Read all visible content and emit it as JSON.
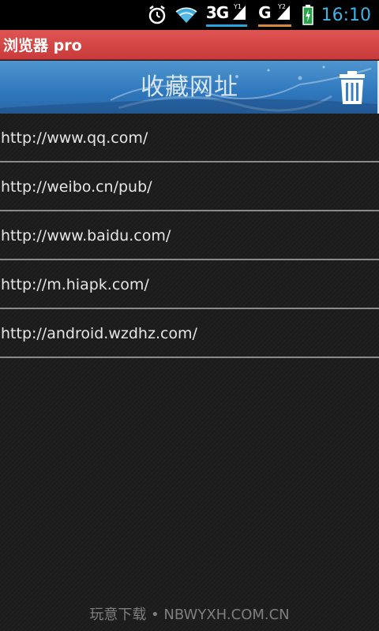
{
  "status_bar": {
    "time": "16:10",
    "network_1": "3G",
    "network_2": "G",
    "icons": [
      "alarm-icon",
      "wifi-icon",
      "signal-1-icon",
      "signal-2-icon",
      "battery-charging-icon"
    ],
    "colors": {
      "clock": "#3fb3e6",
      "net1_underline": "#29a3d9",
      "net2_underline": "#d28a3a"
    }
  },
  "app_bar": {
    "title": "浏览器 pro",
    "color": "#d94848"
  },
  "header": {
    "title": "收藏网址",
    "action_icon": "trash-icon",
    "color": "#3a82c6"
  },
  "bookmarks": [
    {
      "url": "http://www.qq.com/"
    },
    {
      "url": "http://weibo.cn/pub/"
    },
    {
      "url": "http://www.baidu.com/"
    },
    {
      "url": "http://m.hiapk.com/"
    },
    {
      "url": "http://android.wzdhz.com/"
    }
  ],
  "watermark": "玩意下载 • NBWYXH.COM.CN"
}
